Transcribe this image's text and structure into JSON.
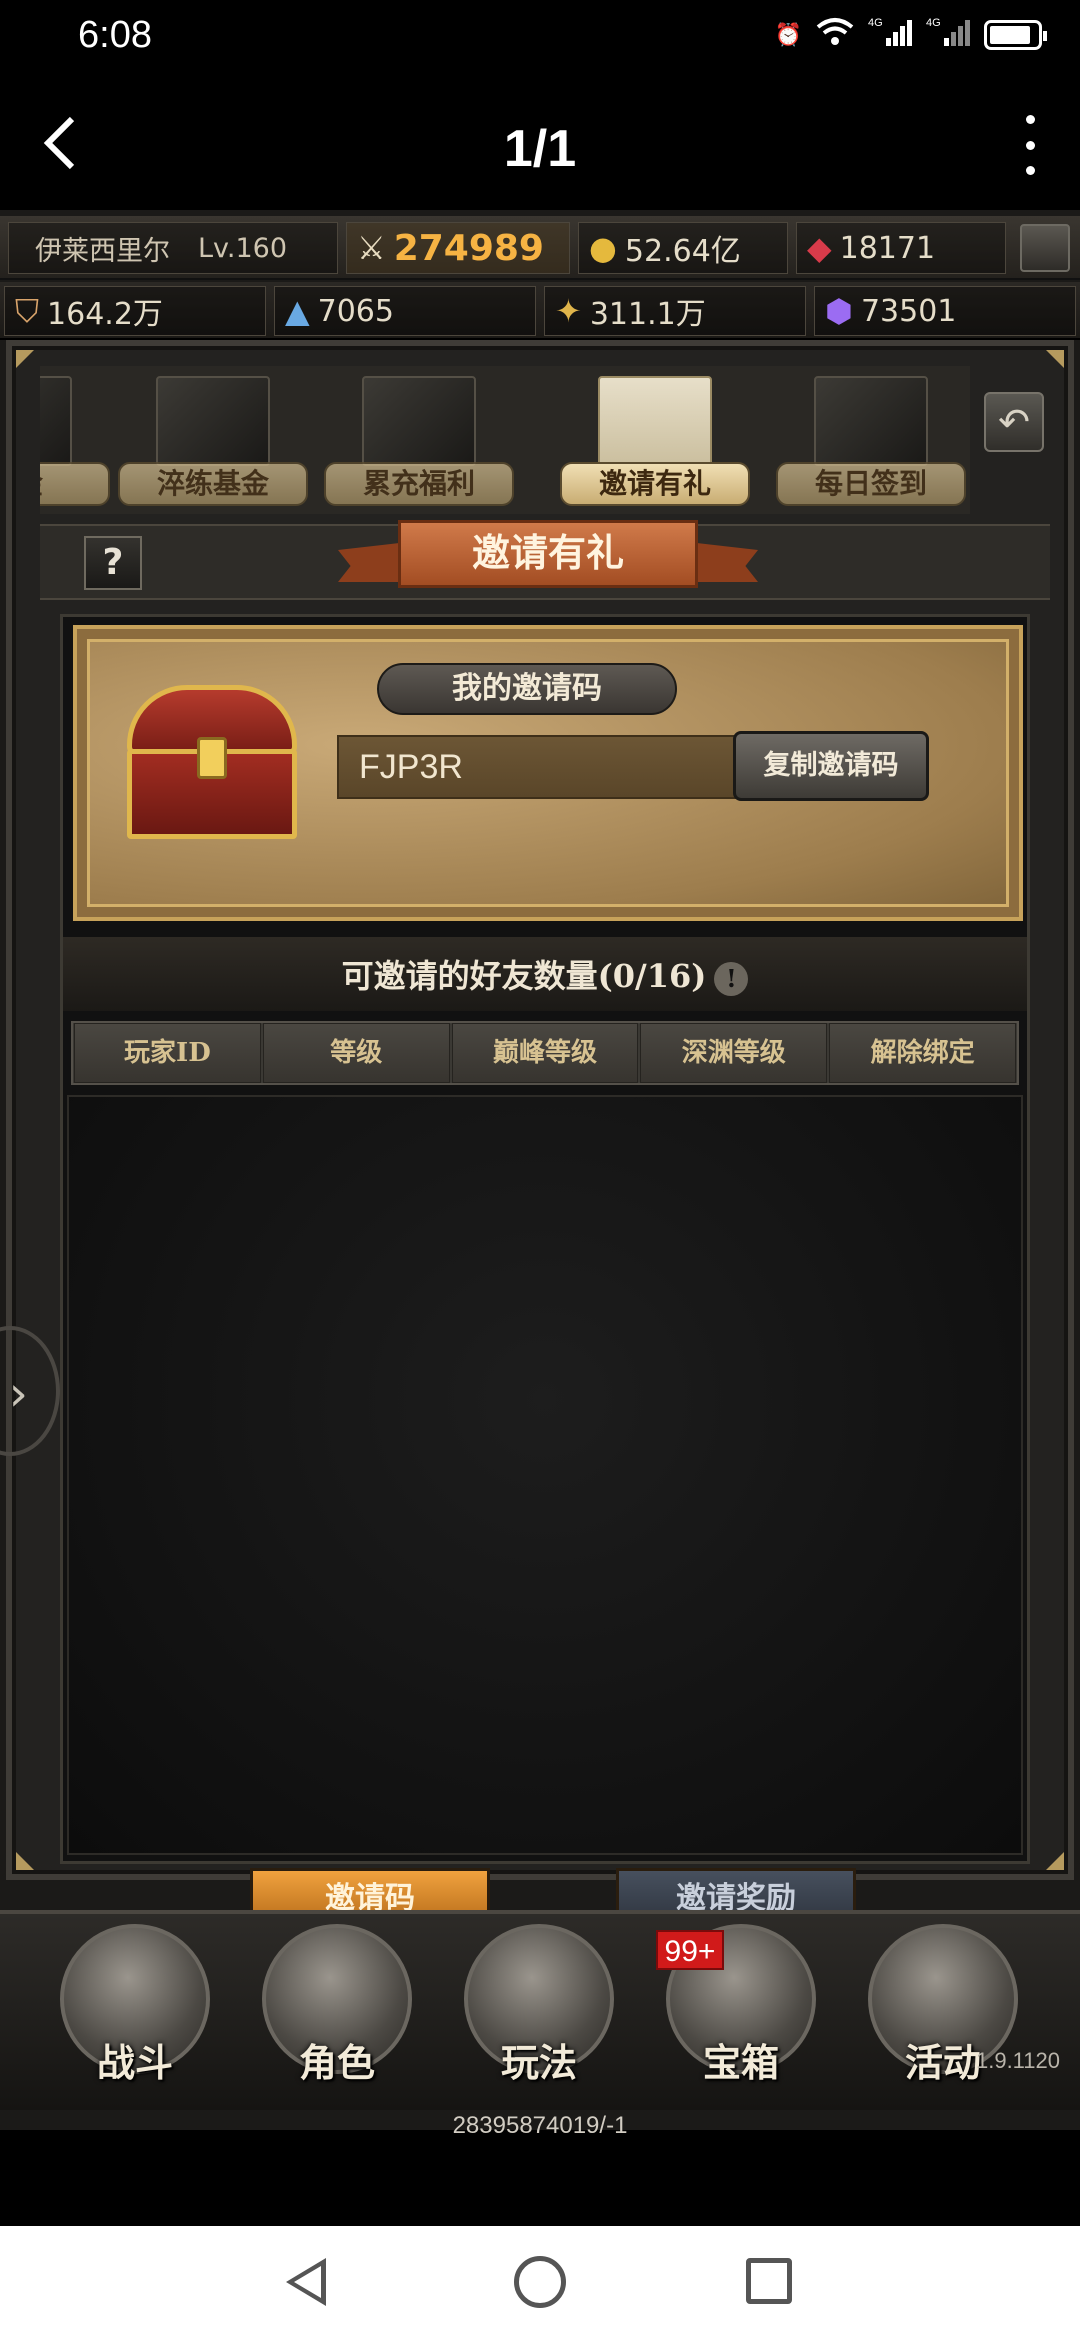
{
  "status_bar": {
    "time": "6:08",
    "signal_labels": [
      "4G",
      "4G"
    ]
  },
  "app_bar": {
    "title": "1/1"
  },
  "resources": {
    "player_name": "伊莱西里尔",
    "player_level": "Lv.160",
    "combat_power": "274989",
    "gold": "52.64亿",
    "gems": "18171",
    "res_1": "164.2万",
    "res_2": "7065",
    "res_3": "311.1万",
    "res_4": "73501"
  },
  "tabs": [
    {
      "label": "基金"
    },
    {
      "label": "淬练基金"
    },
    {
      "label": "累充福利"
    },
    {
      "label": "邀请有礼",
      "active": true
    },
    {
      "label": "每日签到"
    }
  ],
  "panel": {
    "help": "?",
    "title": "邀请有礼",
    "my_code_label": "我的邀请码",
    "code_value": "FJP3R",
    "copy_button": "复制邀请码",
    "friend_count": "可邀请的好友数量(0/16)",
    "info_mark": "!",
    "columns": [
      "玩家ID",
      "等级",
      "巅峰等级",
      "深渊等级",
      "解除绑定"
    ]
  },
  "bottom_tabs": {
    "active": "邀请码",
    "inactive": "邀请奖励"
  },
  "nav": {
    "items": [
      "战斗",
      "角色",
      "玩法",
      "宝箱",
      "活动"
    ],
    "badge": "99+",
    "version": "1.9.1120",
    "footer_id": "28395874019/-1"
  }
}
